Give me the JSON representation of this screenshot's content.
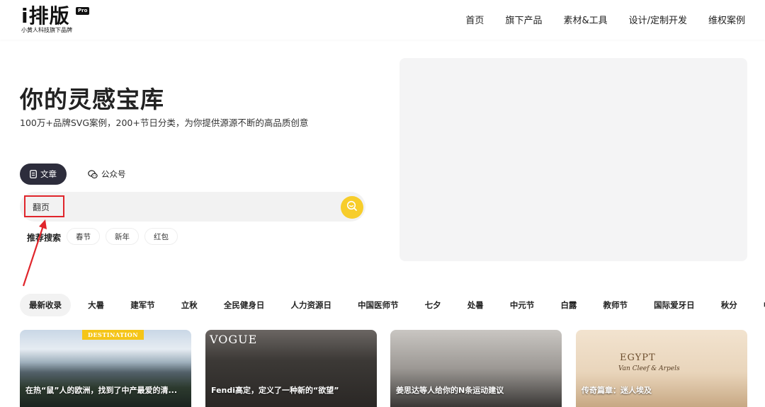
{
  "header": {
    "logo_text": "i排版",
    "logo_badge": "Pro",
    "logo_subtitle": "小黄人科技旗下品牌",
    "nav": [
      "首页",
      "旗下产品",
      "素材&工具",
      "设计/定制开发",
      "维权案例"
    ]
  },
  "hero": {
    "title": "你的灵感宝库",
    "subtitle": "100万+品牌SVG案例，200+节日分类，为你提供源源不断的高品质创意"
  },
  "tabs": {
    "article_label": "文章",
    "account_label": "公众号"
  },
  "search": {
    "value": "翻页",
    "hot_label": "推荐搜索",
    "hot_tags": [
      "春节",
      "新年",
      "红包"
    ]
  },
  "categories": [
    "最新收录",
    "大暑",
    "建军节",
    "立秋",
    "全民健身日",
    "人力资源日",
    "中国医师节",
    "七夕",
    "处暑",
    "中元节",
    "白露",
    "教师节",
    "国际爱牙日",
    "秋分",
    "中秋"
  ],
  "cards": [
    {
      "title": "在热“鼠”人的欧洲，找到了中产最爱的清...",
      "tag": "DESTINATION"
    },
    {
      "title": "Fendi高定，定义了一种新的“欲望”",
      "tag": "VOGUE"
    },
    {
      "title": "姜思达等人给你的N条运动建议",
      "tag": ""
    },
    {
      "title": "传奇篇章：迷人埃及",
      "tag": "EGYPT",
      "brand": "Van Cleef & Arpels"
    }
  ],
  "colors": {
    "accent_yellow": "#f7cd2b",
    "tab_active_bg": "#2d2d3c",
    "annotation_red": "#e0252b"
  }
}
